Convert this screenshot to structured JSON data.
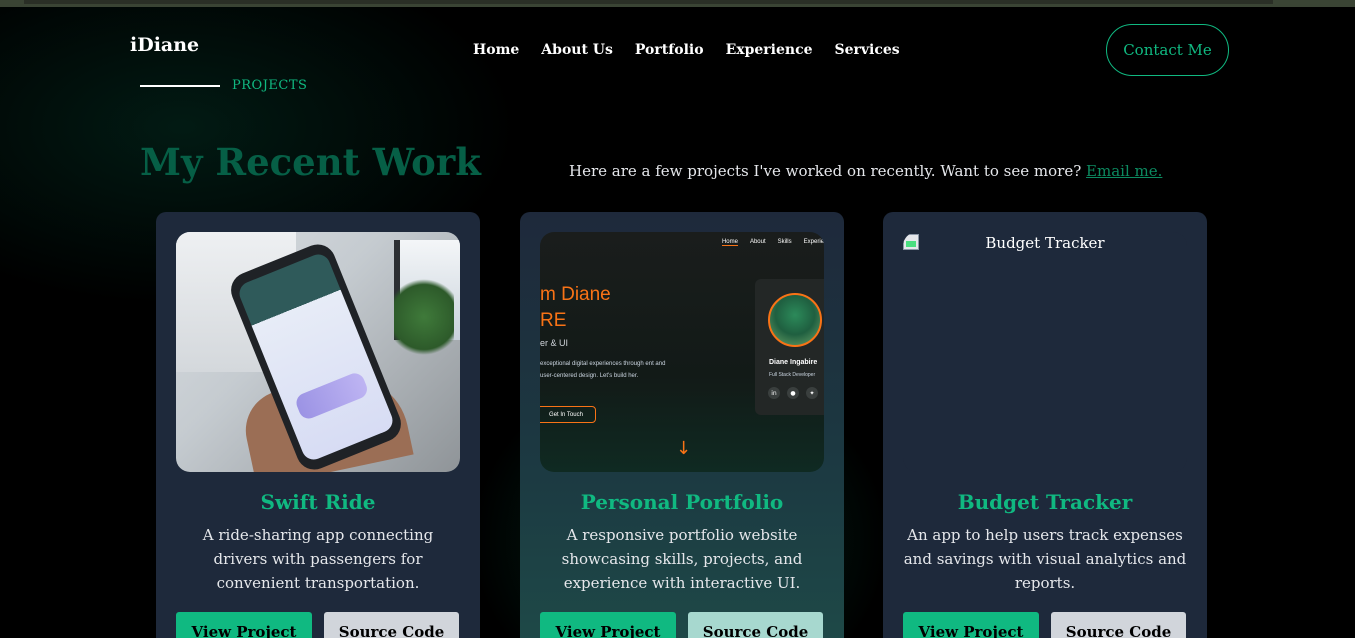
{
  "brand": {
    "logo": "iDiane"
  },
  "nav": {
    "items": [
      "Home",
      "About Us",
      "Portfolio",
      "Experience",
      "Services"
    ],
    "contact_label": "Contact Me"
  },
  "section": {
    "label": "PROJECTS",
    "heading": "My Recent Work",
    "intro_text": "Here are a few projects I've worked on recently. Want to see more?",
    "intro_link": "Email me."
  },
  "projects": [
    {
      "title": "Swift Ride",
      "description": "A ride-sharing app connecting drivers with passengers for convenient transportation.",
      "view_label": "View Project",
      "source_label": "Source Code"
    },
    {
      "title": "Personal Portfolio",
      "description": "A responsive portfolio website showcasing skills, projects, and experience with interactive UI.",
      "view_label": "View Project",
      "source_label": "Source Code",
      "preview": {
        "nav": [
          "Home",
          "About",
          "Skills",
          "Experie"
        ],
        "name_line1": "m Diane",
        "name_line2": "RE",
        "role": "er & UI",
        "text": "exceptional digital experiences through ent and user-centered design. Let's build her.",
        "button": "Get In Touch",
        "card_name": "Diane Ingabire",
        "card_role": "Full Stack Developer"
      }
    },
    {
      "title": "Budget Tracker",
      "description": "An app to help users track expenses and savings with visual analytics and reports.",
      "view_label": "View Project",
      "source_label": "Source Code",
      "image_alt": "Budget Tracker"
    }
  ],
  "colors": {
    "accent": "#10b981",
    "heading": "#065f46",
    "card_bg": "#1e293b",
    "preview_accent": "#f97316"
  }
}
